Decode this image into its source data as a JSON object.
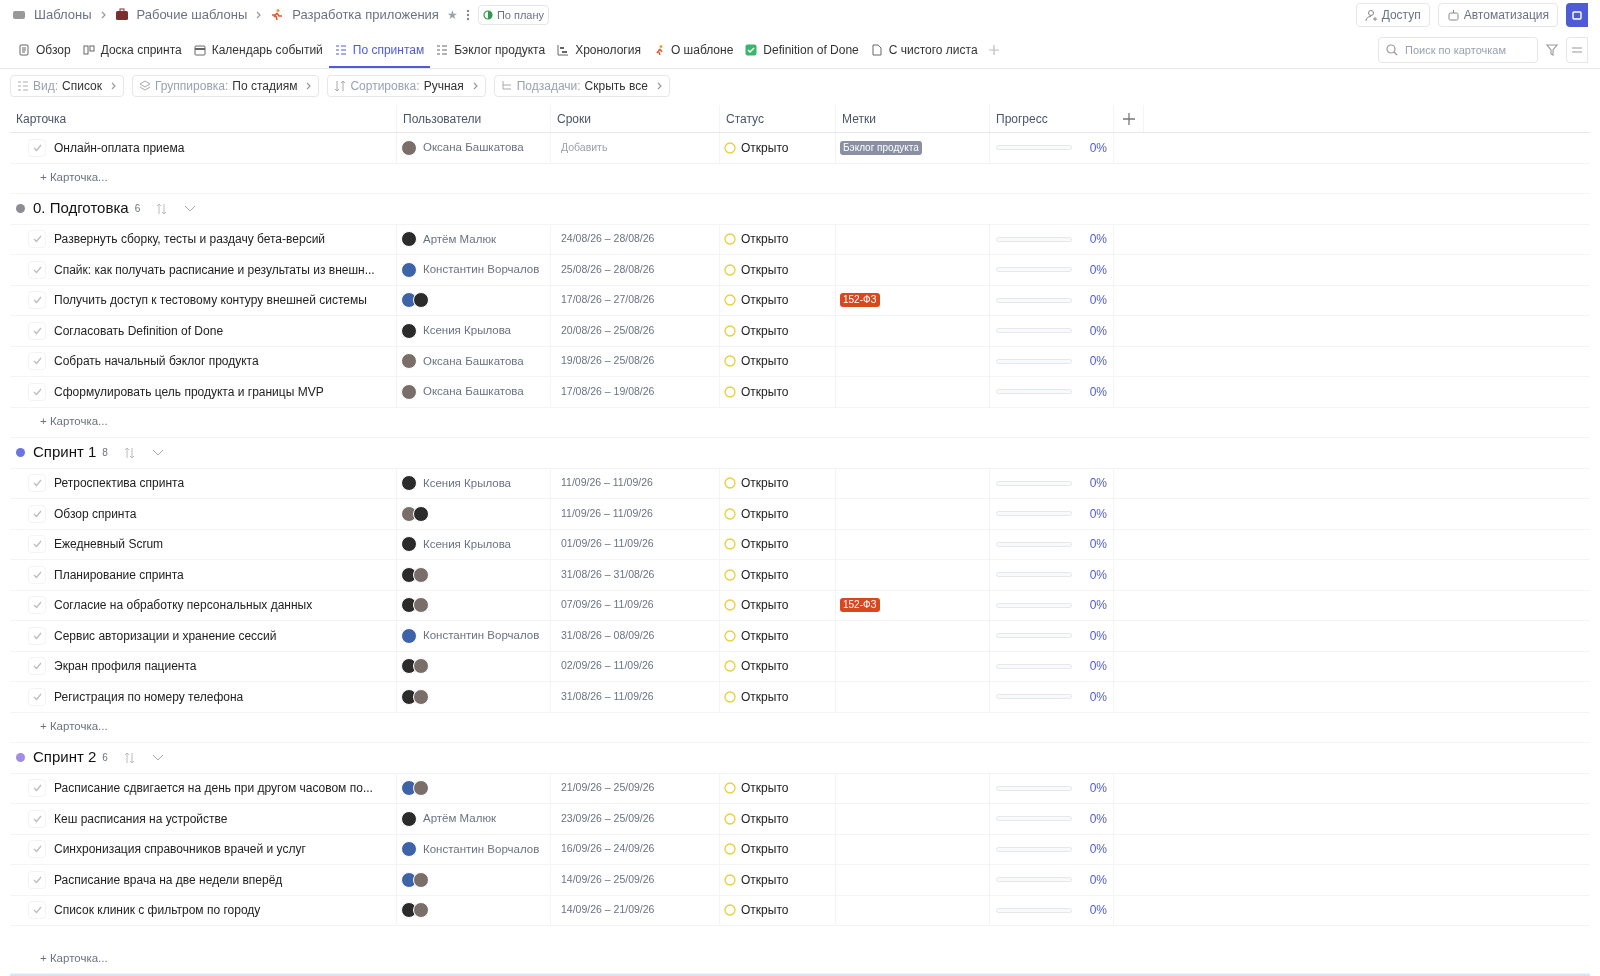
{
  "breadcrumbs": [
    {
      "label": "Шаблоны"
    },
    {
      "label": "Рабочие шаблоны"
    },
    {
      "label": "Разработка приложения"
    }
  ],
  "star": "★",
  "plan_badge": "По плану",
  "header_buttons": [
    {
      "label": "Доступ",
      "kind": "access"
    },
    {
      "label": "Автоматизация",
      "kind": "automation"
    }
  ],
  "tabs": [
    {
      "label": "Обзор",
      "selected": false
    },
    {
      "label": "Доска спринта",
      "selected": false
    },
    {
      "label": "Календарь событий",
      "selected": false
    },
    {
      "label": "По спринтам",
      "selected": true
    },
    {
      "label": "Бэклог продукта",
      "selected": false
    },
    {
      "label": "Хронология",
      "selected": false
    },
    {
      "label": "О шаблоне",
      "selected": false
    },
    {
      "label": "Definition of Done",
      "selected": false
    },
    {
      "label": "С чистого листа",
      "selected": false
    }
  ],
  "search": {
    "placeholder": "Поиск по карточкам"
  },
  "view_options": [
    {
      "label": "Вид:",
      "value": "Список"
    },
    {
      "label": "Группировка:",
      "value": "По стадиям"
    },
    {
      "label": "Сортировка:",
      "value": "Ручная"
    },
    {
      "label": "Подзадачи:",
      "value": "Скрыть все"
    }
  ],
  "table": {
    "columns": [
      "Карточка",
      "Пользователи",
      "Сроки",
      "Статус",
      "Метки",
      "Прогресс"
    ],
    "top_add_card": "+ Карточка...",
    "top_rows": [
      {
        "title": "Онлайн-оплата приема",
        "done": false,
        "assignees": [
          {
            "kind": "grey",
            "name": "Оксана Башкатова"
          }
        ],
        "dates": "Добавить",
        "dates_empty": true,
        "status": "Открыто",
        "tags": [
          {
            "label": "Бэклог продукта",
            "color": "#8a8fa3"
          }
        ],
        "level": 0,
        "progress": "0%"
      }
    ],
    "groups": [
      {
        "title": "0. Подготовка",
        "count": "6",
        "color": "#8c8c94",
        "add_card": "+ Карточка...",
        "rows": [
          {
            "title": "Развернуть сборку, тесты и раздачу бета-версий",
            "done": false,
            "assignees": [
              {
                "kind": "dark",
                "name": "Артём Малюк"
              }
            ],
            "dates": "24/08/26 – 28/08/26",
            "status": "Открыто",
            "tags": [],
            "level": 0,
            "progress": "0%"
          },
          {
            "title": "Спайк: как получать расписание и результаты из внешн...",
            "done": false,
            "assignees": [
              {
                "kind": "blue",
                "name": "Константин Ворчалов"
              }
            ],
            "dates": "25/08/26 – 28/08/26",
            "status": "Открыто",
            "tags": [],
            "level": 0,
            "progress": "0%"
          },
          {
            "title": "Получить доступ к тестовому контуру внешней системы",
            "done": false,
            "assignees": [
              {
                "kind": "blue"
              },
              {
                "kind": "dark"
              }
            ],
            "dates": "17/08/26 – 27/08/26",
            "status": "Открыто",
            "tags": [
              {
                "label": "152-ФЗ",
                "color": "#d9471f"
              }
            ],
            "level": 0,
            "progress": "0%"
          },
          {
            "title": "Согласовать Definition of Done",
            "done": false,
            "assignees": [
              {
                "kind": "dark",
                "name": "Ксения Крылова"
              }
            ],
            "dates": "20/08/26 – 25/08/26",
            "status": "Открыто",
            "tags": [],
            "level": 0,
            "progress": "0%"
          },
          {
            "title": "Собрать начальный бэклог продукта",
            "done": false,
            "assignees": [
              {
                "kind": "grey",
                "name": "Оксана Башкатова"
              }
            ],
            "dates": "19/08/26 – 25/08/26",
            "status": "Открыто",
            "tags": [],
            "level": 0,
            "progress": "0%"
          },
          {
            "title": "Сформулировать цель продукта и границы MVP",
            "done": false,
            "assignees": [
              {
                "kind": "grey",
                "name": "Оксана Башкатова"
              }
            ],
            "dates": "17/08/26 – 19/08/26",
            "status": "Открыто",
            "tags": [],
            "level": 0,
            "progress": "0%"
          }
        ]
      },
      {
        "title": "Спринт 1",
        "count": "8",
        "color": "#6b74e0",
        "add_card": "+ Карточка...",
        "rows": [
          {
            "title": "Ретроспектива спринта",
            "done": false,
            "assignees": [
              {
                "kind": "dark",
                "name": "Ксения Крылова"
              }
            ],
            "dates": "11/09/26 – 11/09/26",
            "status": "Открыто",
            "tags": [],
            "level": 0,
            "progress": "0%"
          },
          {
            "title": "Обзор спринта",
            "done": false,
            "assignees": [
              {
                "kind": "grey"
              },
              {
                "kind": "dark"
              }
            ],
            "dates": "11/09/26 – 11/09/26",
            "status": "Открыто",
            "tags": [],
            "level": 0,
            "progress": "0%"
          },
          {
            "title": "Ежедневный Scrum",
            "done": false,
            "assignees": [
              {
                "kind": "dark",
                "name": "Ксения Крылова"
              }
            ],
            "dates": "01/09/26 – 11/09/26",
            "status": "Открыто",
            "tags": [],
            "level": 0,
            "progress": "0%"
          },
          {
            "title": "Планирование спринта",
            "done": false,
            "assignees": [
              {
                "kind": "dark"
              },
              {
                "kind": "grey"
              }
            ],
            "dates": "31/08/26 – 31/08/26",
            "status": "Открыто",
            "tags": [],
            "level": 0,
            "progress": "0%"
          },
          {
            "title": "Согласие на обработку персональных данных",
            "done": false,
            "assignees": [
              {
                "kind": "dark"
              },
              {
                "kind": "grey"
              }
            ],
            "dates": "07/09/26 – 11/09/26",
            "status": "Открыто",
            "tags": [
              {
                "label": "152-ФЗ",
                "color": "#d9471f"
              }
            ],
            "level": 0,
            "progress": "0%"
          },
          {
            "title": "Сервис авторизации и хранение сессий",
            "done": false,
            "assignees": [
              {
                "kind": "blue",
                "name": "Константин Ворчалов"
              }
            ],
            "dates": "31/08/26 – 08/09/26",
            "status": "Открыто",
            "tags": [],
            "level": 0,
            "progress": "0%"
          },
          {
            "title": "Экран профиля пациента",
            "done": false,
            "assignees": [
              {
                "kind": "dark"
              },
              {
                "kind": "grey"
              }
            ],
            "dates": "02/09/26 – 11/09/26",
            "status": "Открыто",
            "tags": [],
            "level": 0,
            "progress": "0%"
          },
          {
            "title": "Регистрация по номеру телефона",
            "done": false,
            "assignees": [
              {
                "kind": "dark"
              },
              {
                "kind": "grey"
              }
            ],
            "dates": "31/08/26 – 11/09/26",
            "status": "Открыто",
            "tags": [],
            "level": 0,
            "progress": "0%"
          }
        ]
      },
      {
        "title": "Спринт 2",
        "count": "6",
        "color": "#a28ce6",
        "add_card": "+ Карточка...",
        "rows": [
          {
            "title": "Расписание сдвигается на день при другом часовом по...",
            "done": false,
            "assignees": [
              {
                "kind": "blue"
              },
              {
                "kind": "grey"
              }
            ],
            "dates": "21/09/26 – 25/09/26",
            "status": "Открыто",
            "tags": [],
            "level": 0,
            "progress": "0%"
          },
          {
            "title": "Кеш расписания на устройстве",
            "done": false,
            "assignees": [
              {
                "kind": "dark",
                "name": "Артём Малюк"
              }
            ],
            "dates": "23/09/26 – 25/09/26",
            "status": "Открыто",
            "tags": [],
            "level": 0,
            "progress": "0%"
          },
          {
            "title": "Синхронизация справочников врачей и услуг",
            "done": false,
            "assignees": [
              {
                "kind": "blue",
                "name": "Константин Ворчалов"
              }
            ],
            "dates": "16/09/26 – 24/09/26",
            "status": "Открыто",
            "tags": [],
            "level": 0,
            "progress": "0%"
          },
          {
            "title": "Расписание врача на две недели вперёд",
            "done": false,
            "assignees": [
              {
                "kind": "blue"
              },
              {
                "kind": "grey"
              }
            ],
            "dates": "14/09/26 – 25/09/26",
            "status": "Открыто",
            "tags": [],
            "level": 0,
            "progress": "0%"
          },
          {
            "title": "Список клиник с фильтром по городу",
            "done": false,
            "assignees": [
              {
                "kind": "dark"
              },
              {
                "kind": "grey"
              }
            ],
            "dates": "14/09/26 – 21/09/26",
            "status": "Открыто",
            "tags": [],
            "level": 0,
            "progress": "0%"
          }
        ]
      }
    ]
  }
}
